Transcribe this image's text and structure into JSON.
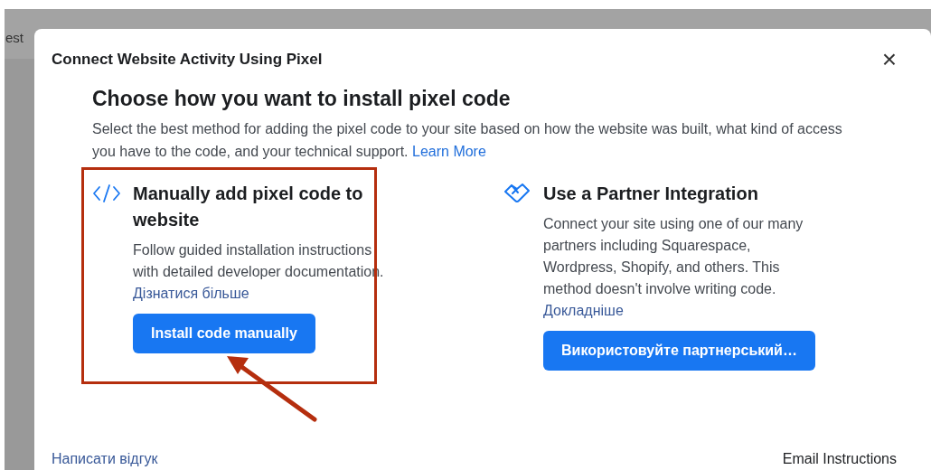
{
  "background": {
    "tab_text": "est"
  },
  "dialog": {
    "title": "Connect Website Activity Using Pixel",
    "close": "×",
    "heading": "Choose how you want to install pixel code",
    "description": "Select the best method for adding the pixel code to your site based on how the website was built, what kind of access you have to the code, and your technical support.",
    "description_link": "Learn More",
    "options": [
      {
        "kind": "code",
        "title": "Manually add pixel code to website",
        "text": "Follow guided installation instructions with detailed developer documentation.",
        "link": "Дізнатися більше",
        "button": "Install code manually",
        "highlighted": true
      },
      {
        "kind": "partner",
        "title": "Use a Partner Integration",
        "text": "Connect your site using one of our many partners including Squarespace, Wordpress, Shopify, and others. This method doesn't involve writing code.",
        "link": "Докладніше",
        "button": "Використовуйте партнерський…",
        "highlighted": false
      }
    ],
    "footer": {
      "feedback_link": "Написати відгук",
      "email_link": "Email Instructions"
    }
  }
}
